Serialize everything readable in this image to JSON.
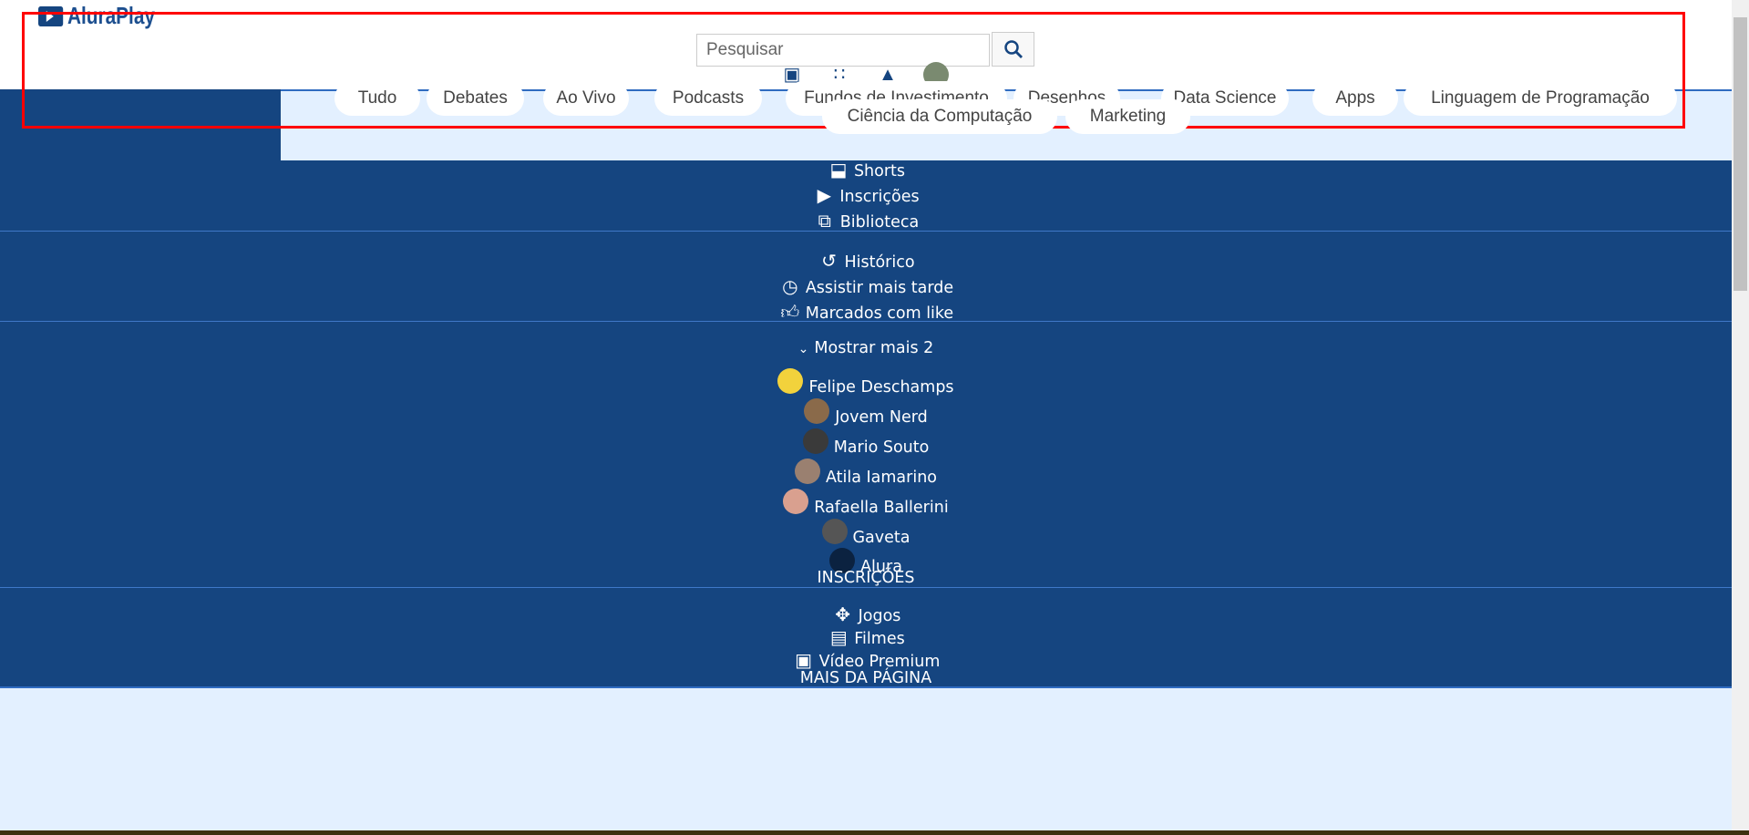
{
  "header": {
    "logo_text": "AluraPlay",
    "search_placeholder": "Pesquisar",
    "icons": [
      "search-icon",
      "add-video-icon",
      "apps-grid-icon",
      "bell-icon",
      "user-avatar"
    ]
  },
  "chips": [
    "Tudo",
    "Debates",
    "Ao Vivo",
    "Podcasts",
    "Fundos de Investimento",
    "Desenhos",
    "Data Science",
    "Apps",
    "Linguagem de Programação",
    "Ciência da Computação",
    "Marketing"
  ],
  "sidebar": {
    "section1": [
      {
        "label": "Shorts",
        "icon": "shorts-icon"
      },
      {
        "label": "Inscrições",
        "icon": "subscriptions-icon"
      },
      {
        "label": "Biblioteca",
        "icon": "library-icon"
      }
    ],
    "section2": [
      {
        "label": "Histórico",
        "icon": "history-icon"
      },
      {
        "label": "Assistir mais tarde",
        "icon": "watch-later-icon"
      },
      {
        "label": "Marcados com like",
        "icon": "thumbs-up-icon"
      }
    ],
    "show_more": "Mostrar mais 2",
    "channels": [
      {
        "label": "Felipe Deschamps",
        "color": "#f2d23c"
      },
      {
        "label": "Jovem Nerd",
        "color": "#8a6a4a"
      },
      {
        "label": "Mario Souto",
        "color": "#3a3a3a"
      },
      {
        "label": "Atila Iamarino",
        "color": "#9a8070"
      },
      {
        "label": "Rafaella Ballerini",
        "color": "#d9a08f"
      },
      {
        "label": "Gaveta",
        "color": "#555"
      },
      {
        "label": "Alura",
        "color": "#0b2240"
      }
    ],
    "subscriptions_heading": "INSCRIÇÕES",
    "section4": [
      {
        "label": "Jogos",
        "icon": "gamepad-icon"
      },
      {
        "label": "Filmes",
        "icon": "clapperboard-icon"
      },
      {
        "label": "Vídeo Premium",
        "icon": "premium-video-icon"
      }
    ],
    "more_heading": "MAIS DA PÁGINA"
  },
  "colors": {
    "primary": "#154580",
    "background": "#e3f0ff",
    "highlight": "#ff0000"
  }
}
